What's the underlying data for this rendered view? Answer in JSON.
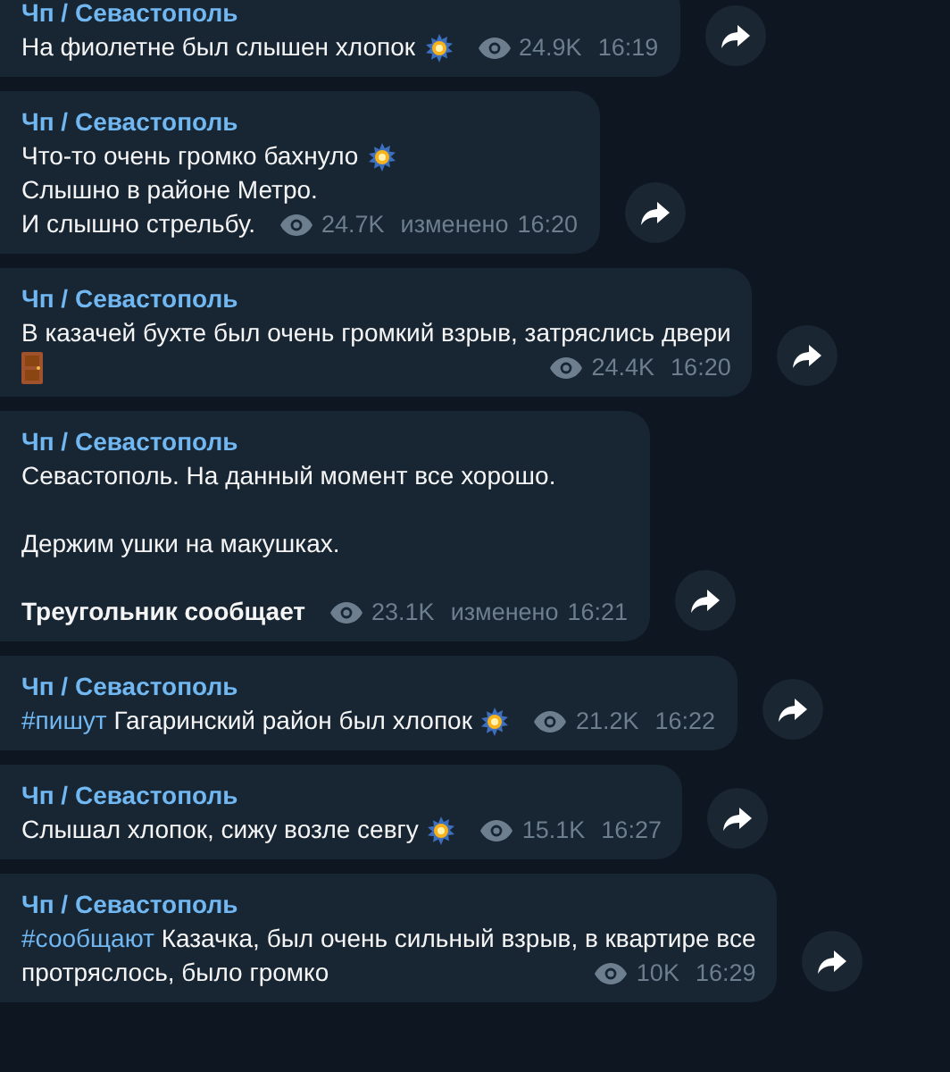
{
  "messages": [
    {
      "author": "Чп / Севастополь",
      "paragraphs": [
        [
          {
            "kind": "burst",
            "text": "На фиолетне был слышен хлопок"
          }
        ]
      ],
      "views": "24.9K",
      "time": "16:19"
    },
    {
      "author": "Чп / Севастополь",
      "paragraphs": [
        [
          {
            "kind": "burst",
            "text": "Что-то очень громко бахнуло"
          },
          {
            "kind": "plain",
            "text": "Слышно в районе Метро."
          },
          {
            "kind": "plain",
            "text": "И слышно стрельбу."
          }
        ]
      ],
      "views": "24.7K",
      "edited": "изменено",
      "time": "16:20"
    },
    {
      "author": "Чп / Севастополь",
      "paragraphs": [
        [
          {
            "kind": "plain",
            "text": "В казачей бухте был очень громкий взрыв, затряслись двери"
          },
          {
            "kind": "door"
          }
        ]
      ],
      "views": "24.4K",
      "time": "16:20"
    },
    {
      "author": "Чп / Севастополь",
      "paragraphs": [
        [
          {
            "kind": "plain",
            "text": "Севастополь. На данный момент все хорошо."
          }
        ],
        [
          {
            "kind": "plain",
            "text": "Держим ушки на макушках."
          }
        ],
        [
          {
            "kind": "plain",
            "text": "Треугольник сообщает",
            "bold": true
          }
        ]
      ],
      "views": "23.1K",
      "edited": "изменено",
      "time": "16:21"
    },
    {
      "author": "Чп / Севастополь",
      "paragraphs": [
        [
          {
            "kind": "burst",
            "hashtag": "#пишут",
            "text": "Гагаринский район был хлопок"
          }
        ]
      ],
      "views": "21.2K",
      "time": "16:22"
    },
    {
      "author": "Чп / Севастополь",
      "paragraphs": [
        [
          {
            "kind": "burst",
            "text": "Слышал хлопок, сижу возле севгу"
          }
        ]
      ],
      "views": "15.1K",
      "time": "16:27"
    },
    {
      "author": "Чп / Севастополь",
      "paragraphs": [
        [
          {
            "kind": "plain",
            "hashtag": "#сообщают",
            "text": "Казачка, был очень сильный взрыв, в квартире все"
          },
          {
            "kind": "plain",
            "text": "протряслось, было громко"
          }
        ]
      ],
      "views": "10K",
      "time": "16:29"
    }
  ]
}
